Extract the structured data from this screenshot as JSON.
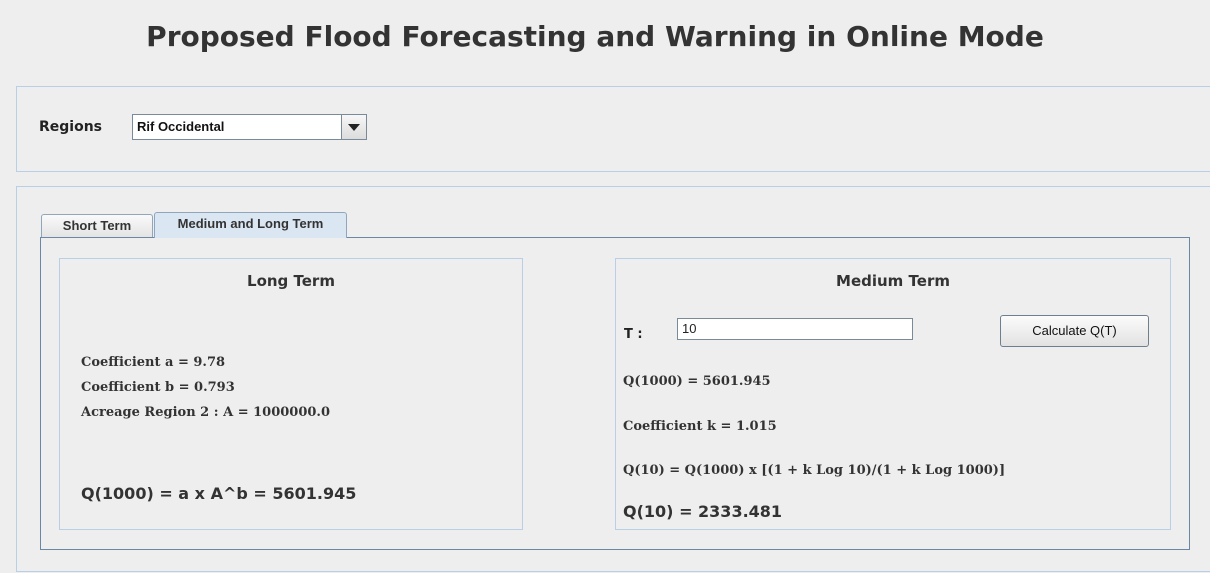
{
  "title": "Proposed Flood Forecasting and Warning in Online Mode",
  "regions": {
    "label": "Regions",
    "selected": "Rif Occidental"
  },
  "tabs": [
    {
      "label": "Short Term",
      "active": false
    },
    {
      "label": "Medium and Long Term",
      "active": true
    }
  ],
  "long_term": {
    "title": "Long Term",
    "coef_a": "Coefficient a = 9.78",
    "coef_b": "Coefficient b = 0.793",
    "acreage": "Acreage Region 2 : A = 1000000.0",
    "result": "Q(1000) = a x A^b = 5601.945"
  },
  "medium_term": {
    "title": "Medium Term",
    "t_label": "T :",
    "t_value": "10",
    "calc_button": "Calculate Q(T)",
    "q1000": "Q(1000) = 5601.945",
    "coef_k": "Coefficient k = 1.015",
    "formula": "Q(10) = Q(1000) x [(1 + k Log 10)/(1 + k Log 1000)]",
    "result": "Q(10) = 2333.481"
  },
  "colors": {
    "background": "#eeeeee",
    "panel_border": "#b8cfe5",
    "active_tab": "#dbe6f3"
  }
}
